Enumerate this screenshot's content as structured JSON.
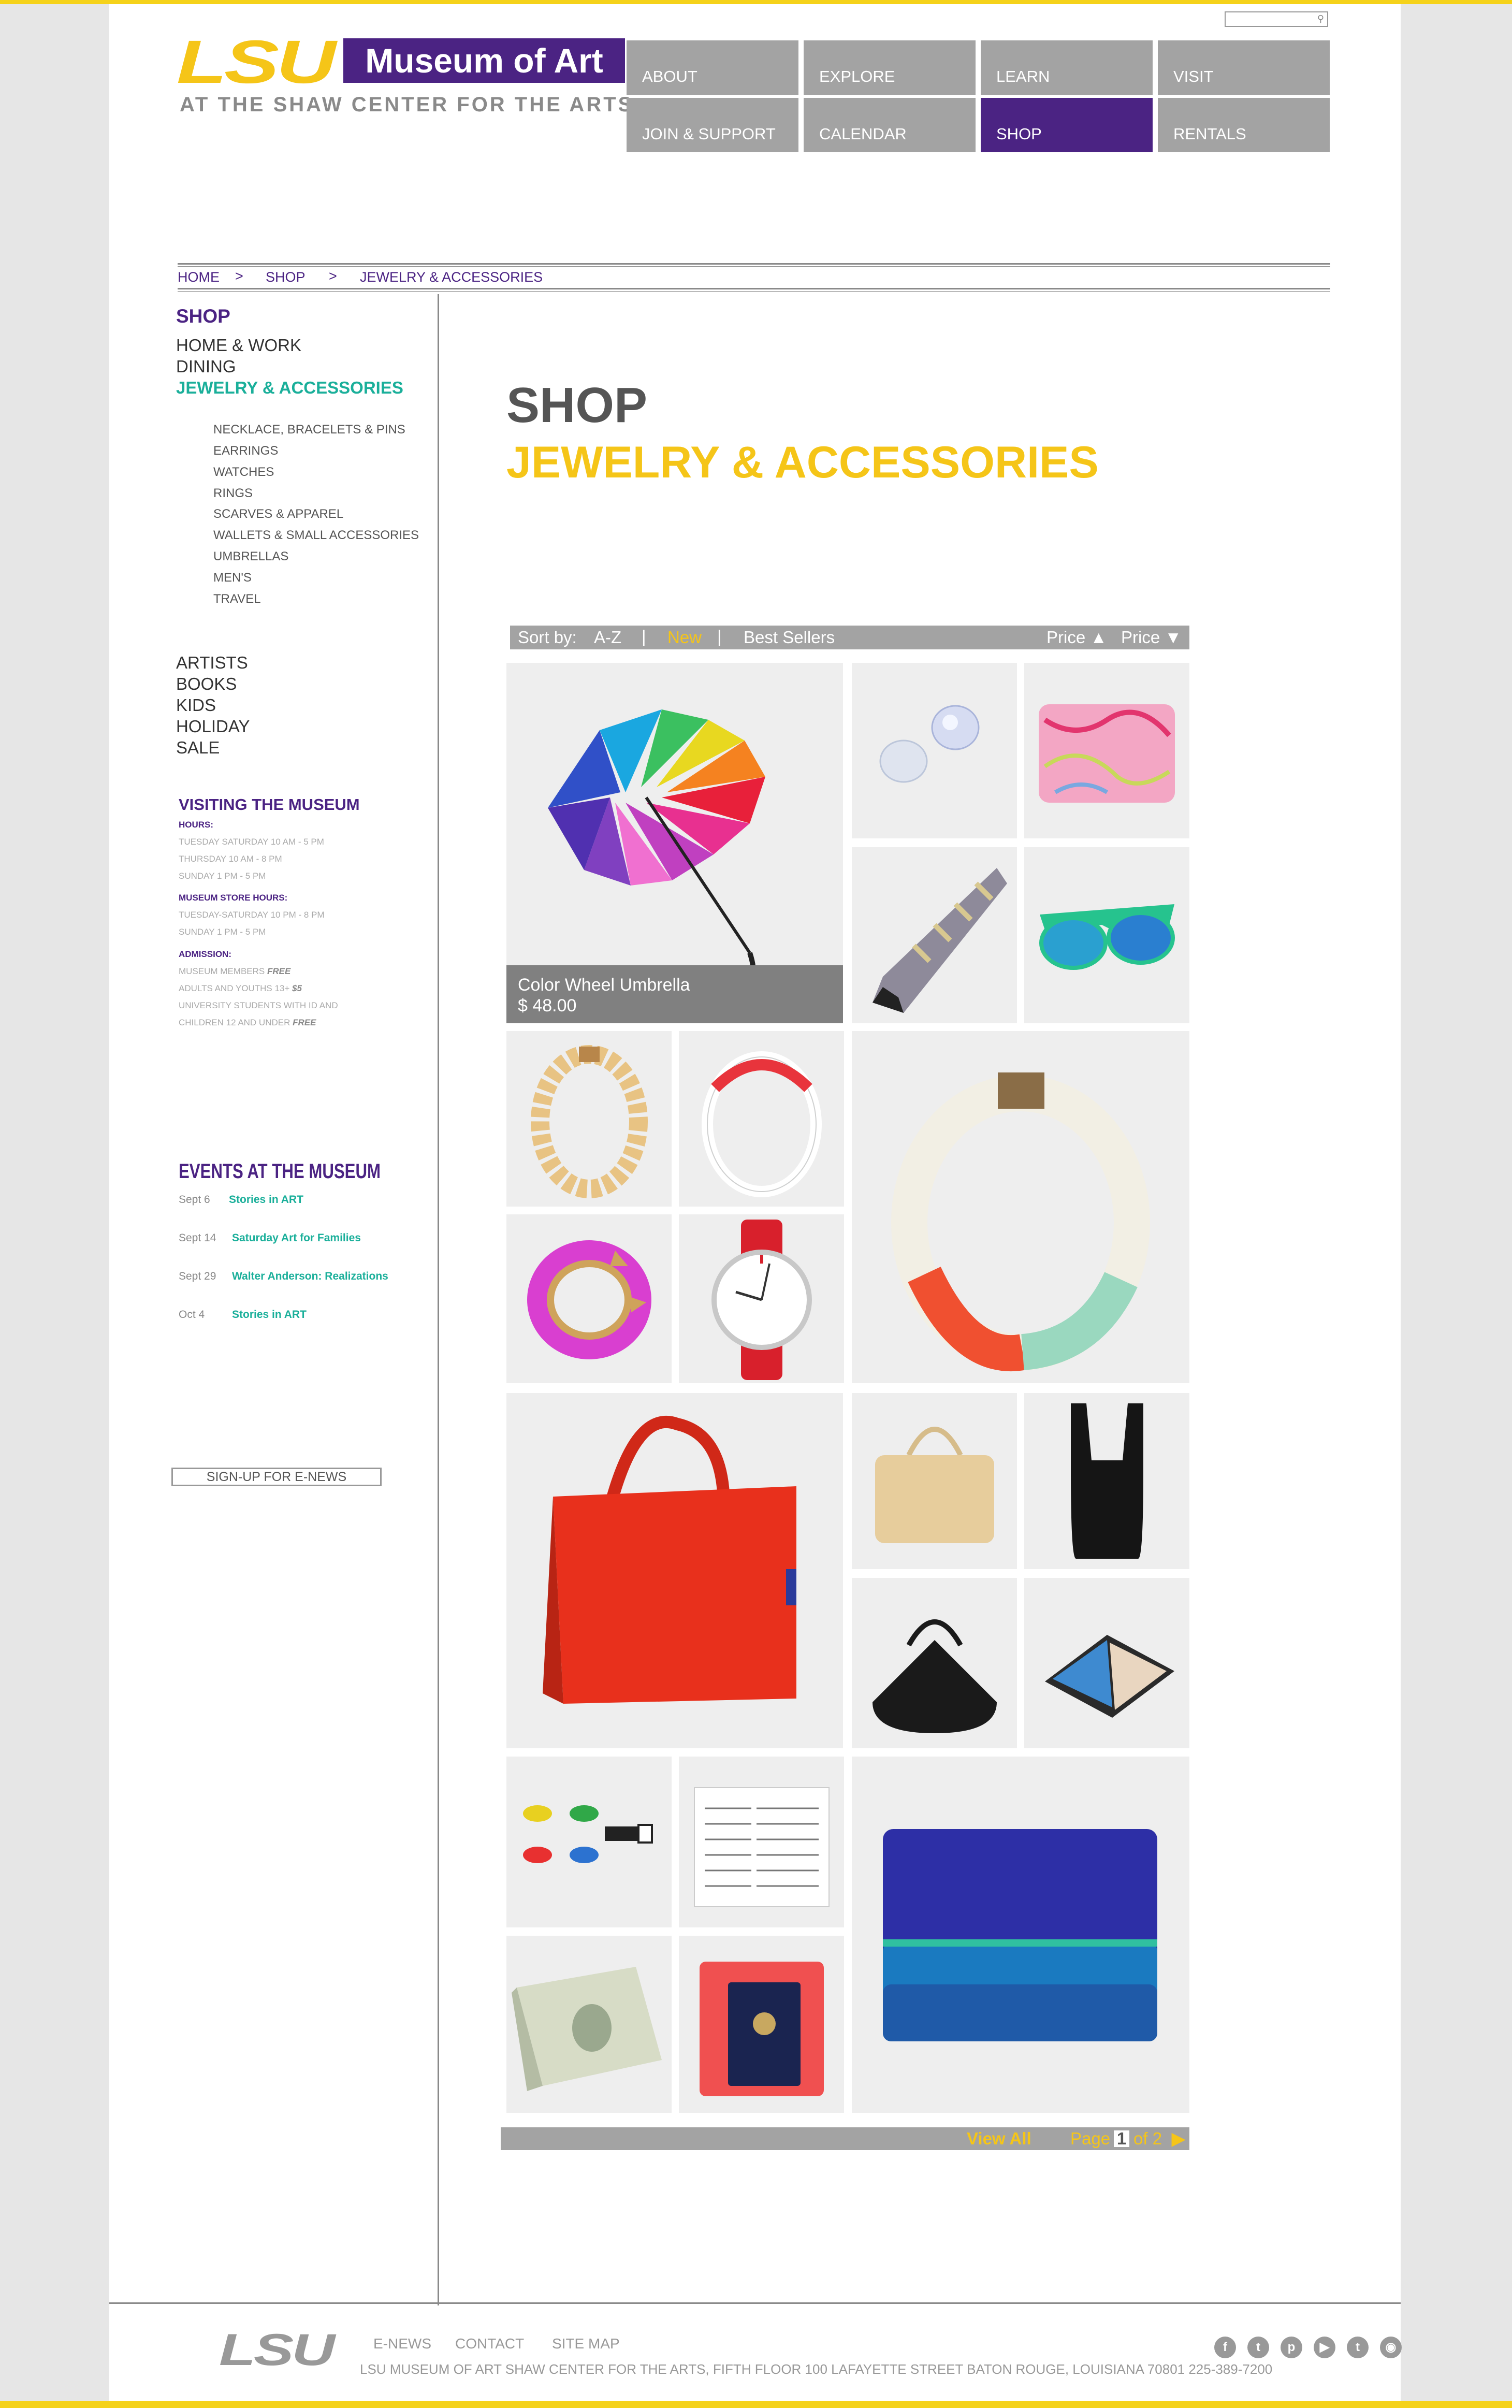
{
  "header": {
    "logo_lsu": "LSU",
    "logo_museum": "Museum of Art",
    "tagline": "AT THE SHAW CENTER FOR THE ARTS",
    "search_placeholder": ""
  },
  "nav": {
    "row1": [
      "ABOUT",
      "EXPLORE",
      "LEARN",
      "VISIT"
    ],
    "row2": [
      "JOIN & SUPPORT",
      "CALENDAR",
      "SHOP",
      "RENTALS"
    ],
    "active": "SHOP"
  },
  "breadcrumb": {
    "items": [
      "HOME",
      "SHOP",
      "JEWELRY & ACCESSORIES"
    ],
    "separator": ">"
  },
  "sidebar": {
    "heading": "SHOP",
    "main_items": [
      "HOME & WORK",
      "DINING",
      "JEWELRY & ACCESSORIES"
    ],
    "sub_items": [
      "NECKLACE, BRACELETS & PINS",
      "EARRINGS",
      "WATCHES",
      "RINGS",
      "SCARVES & APPAREL",
      "WALLETS & SMALL ACCESSORIES",
      "UMBRELLAS",
      "MEN'S",
      "TRAVEL"
    ],
    "other_items": [
      "ARTISTS",
      "BOOKS",
      "KIDS",
      "HOLIDAY",
      "SALE"
    ]
  },
  "visiting": {
    "heading": "VISITING THE MUSEUM",
    "hours_label": "HOURS:",
    "hours": [
      "TUESDAY SATURDAY 10 AM - 5 PM",
      "THURSDAY 10 AM - 8 PM",
      "SUNDAY 1 PM - 5 PM"
    ],
    "store_label": "MUSEUM STORE HOURS:",
    "store_hours": [
      "TUESDAY-SATURDAY 10 PM - 8 PM",
      "SUNDAY 1 PM - 5 PM"
    ],
    "admission_label": "ADMISSION:",
    "admission": [
      {
        "text": "MUSEUM MEMBERS ",
        "em": "FREE"
      },
      {
        "text": "ADULTS AND YOUTHS 13+ ",
        "em": "$5"
      },
      {
        "text": "UNIVERSITY STUDENTS WITH ID AND",
        "em": ""
      },
      {
        "text": "CHILDREN 12 AND UNDER ",
        "em": "FREE"
      }
    ]
  },
  "events": {
    "heading": "EVENTS AT THE MUSEUM",
    "items": [
      {
        "date": "Sept 6",
        "title": "Stories in ART"
      },
      {
        "date": "Sept 14",
        "title": "Saturday Art for Families"
      },
      {
        "date": "Sept 29",
        "title": "Walter Anderson: Realizations"
      },
      {
        "date": "Oct 4",
        "title": "Stories in ART"
      }
    ]
  },
  "signup_label": "SIGN-UP FOR E-NEWS",
  "main": {
    "title": "SHOP",
    "subtitle": "JEWELRY & ACCESSORIES",
    "sort": {
      "label": "Sort by:",
      "az": "A-Z",
      "new": "New",
      "best": "Best Sellers",
      "price_up": "Price ▲",
      "price_down": "Price ▼"
    },
    "featured": {
      "name": "Color Wheel Umbrella",
      "price": "$ 48.00"
    },
    "pagination": {
      "view_all": "View All",
      "page_label": "Page",
      "current": "1",
      "of_label": "of 2",
      "next_icon": "▶"
    }
  },
  "footer": {
    "logo": "LSU",
    "links": [
      "E-NEWS",
      "CONTACT",
      "SITE MAP"
    ],
    "address": "LSU MUSEUM OF ART  SHAW CENTER FOR THE ARTS, FIFTH FLOOR 100 LAFAYETTE STREET BATON ROUGE, LOUISIANA 70801  225-389-7200",
    "social_icons": [
      "facebook-icon",
      "twitter-icon",
      "pinterest-icon",
      "youtube-icon",
      "tumblr-icon",
      "instagram-icon"
    ]
  },
  "colors": {
    "purple": "#4b2383",
    "gold": "#f5c518",
    "teal": "#1aaf9a",
    "gray": "#a3a3a3"
  }
}
